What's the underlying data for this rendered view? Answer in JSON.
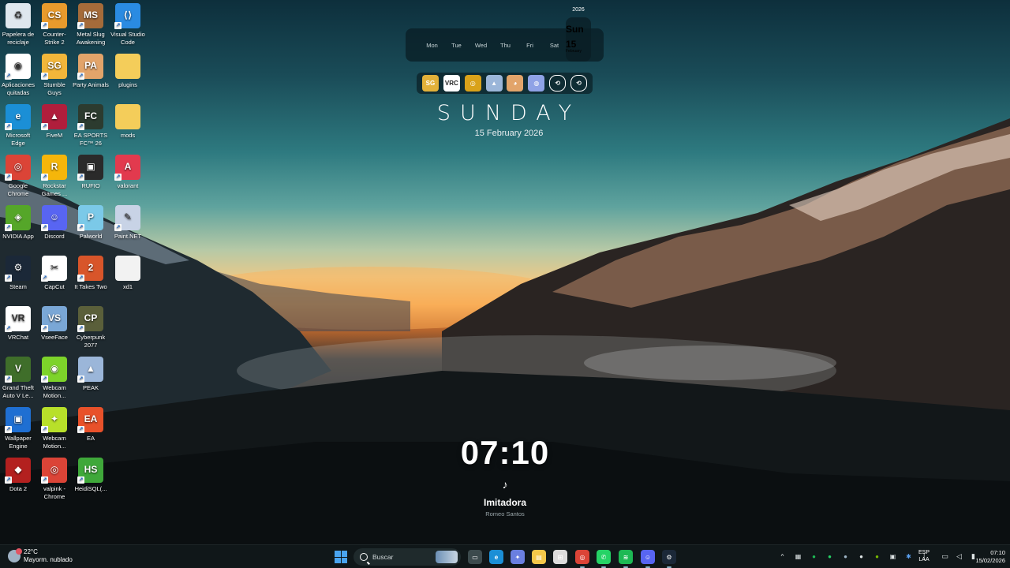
{
  "desktop": {
    "icons": [
      {
        "label": "Papelera de reciclaje",
        "icon": "recycle-bin-icon",
        "color": "#dfe7ee",
        "glyph": "♻"
      },
      {
        "label": "Counter-Strike 2",
        "icon": "counter-strike-icon",
        "color": "#e89a2c",
        "glyph": "CS"
      },
      {
        "label": "Metal Slug Awakening",
        "icon": "metal-slug-icon",
        "color": "#a56b3a",
        "glyph": "MS"
      },
      {
        "label": "Visual Studio Code",
        "icon": "vscode-icon",
        "color": "#2a8be2",
        "glyph": "⟨⟩"
      },
      {
        "label": "Aplicaciones quitadas",
        "icon": "removed-apps-icon",
        "color": "#ffffff",
        "glyph": "◉"
      },
      {
        "label": "Stumble Guys",
        "icon": "stumble-guys-icon",
        "color": "#f2b63a",
        "glyph": "SG"
      },
      {
        "label": "Party Animals",
        "icon": "party-animals-icon",
        "color": "#e2a46a",
        "glyph": "PA"
      },
      {
        "label": "plugins",
        "icon": "folder-icon",
        "color": "#f4cd5a",
        "glyph": ""
      },
      {
        "label": "Microsoft Edge",
        "icon": "edge-icon",
        "color": "#1b8fd6",
        "glyph": "e"
      },
      {
        "label": "FiveM",
        "icon": "fivem-icon",
        "color": "#b01e3c",
        "glyph": "▲"
      },
      {
        "label": "EA SPORTS FC™ 26",
        "icon": "ea-fc-icon",
        "color": "#2c3b2f",
        "glyph": "FC"
      },
      {
        "label": "mods",
        "icon": "folder-icon",
        "color": "#f4cd5a",
        "glyph": ""
      },
      {
        "label": "Google Chrome",
        "icon": "chrome-icon",
        "color": "#db4437",
        "glyph": "◎"
      },
      {
        "label": "Rockstar Games ...",
        "icon": "rockstar-icon",
        "color": "#f5b60a",
        "glyph": "R"
      },
      {
        "label": "RUFIO",
        "icon": "rufio-icon",
        "color": "#2a2a2a",
        "glyph": "▣"
      },
      {
        "label": "valorant",
        "icon": "valorant-icon",
        "color": "#e23a4e",
        "glyph": "A"
      },
      {
        "label": "NVIDIA App",
        "icon": "nvidia-icon",
        "color": "#55a629",
        "glyph": "◈"
      },
      {
        "label": "Discord",
        "icon": "discord-icon",
        "color": "#5865f2",
        "glyph": "☺"
      },
      {
        "label": "Palworld",
        "icon": "palworld-icon",
        "color": "#7bc9e8",
        "glyph": "P"
      },
      {
        "label": "Paint.NET",
        "icon": "paint-net-icon",
        "color": "#c8d3e6",
        "glyph": "✎"
      },
      {
        "label": "Steam",
        "icon": "steam-icon",
        "color": "#1b2838",
        "glyph": "⚙"
      },
      {
        "label": "CapCut",
        "icon": "capcut-icon",
        "color": "#ffffff",
        "glyph": "✂"
      },
      {
        "label": "It Takes Two",
        "icon": "it-takes-two-icon",
        "color": "#d8552a",
        "glyph": "2"
      },
      {
        "label": "xd1",
        "icon": "file-icon",
        "color": "#f2f2f2",
        "glyph": ""
      },
      {
        "label": "VRChat",
        "icon": "vrchat-icon",
        "color": "#ffffff",
        "glyph": "VR"
      },
      {
        "label": "VseeFace",
        "icon": "vseeface-icon",
        "color": "#7aa7d6",
        "glyph": "VS"
      },
      {
        "label": "Cyberpunk 2077",
        "icon": "cyberpunk-icon",
        "color": "#5a5f3a",
        "glyph": "CP"
      },
      {
        "label": "",
        "icon": "blank-icon",
        "color": "transparent",
        "glyph": ""
      },
      {
        "label": "Grand Theft Auto V Le...",
        "icon": "gta-icon",
        "color": "#3f6e2a",
        "glyph": "V"
      },
      {
        "label": "Webcam Motion...",
        "icon": "webcam-motion-icon",
        "color": "#7dd32a",
        "glyph": "◉"
      },
      {
        "label": "PEAK",
        "icon": "peak-icon",
        "color": "#9bb6d9",
        "glyph": "▲"
      },
      {
        "label": "",
        "icon": "blank-icon",
        "color": "transparent",
        "glyph": ""
      },
      {
        "label": "Wallpaper Engine",
        "icon": "wallpaper-engine-icon",
        "color": "#1f6fd2",
        "glyph": "▣"
      },
      {
        "label": "Webcam Motion...",
        "icon": "webcam-motion-icon",
        "color": "#b8e02a",
        "glyph": "✦"
      },
      {
        "label": "EA",
        "icon": "ea-icon",
        "color": "#e8512a",
        "glyph": "EA"
      },
      {
        "label": "",
        "icon": "blank-icon",
        "color": "transparent",
        "glyph": ""
      },
      {
        "label": "Dota 2",
        "icon": "dota2-icon",
        "color": "#b3201f",
        "glyph": "◆"
      },
      {
        "label": "valpink - Chrome",
        "icon": "chrome-icon",
        "color": "#db4437",
        "glyph": "◎"
      },
      {
        "label": "HeidiSQL(...",
        "icon": "heidisql-icon",
        "color": "#3fa83a",
        "glyph": "HS"
      }
    ]
  },
  "calendar": {
    "year": "2026",
    "days": [
      "Mon",
      "Tue",
      "Wed",
      "Thu",
      "Fri",
      "Sat"
    ],
    "today_name": "Sun",
    "today_number": "15",
    "today_month": "February"
  },
  "dock": {
    "items": [
      {
        "icon": "stumble-guys-icon",
        "color": "#e2b13a",
        "glyph": "SG"
      },
      {
        "icon": "vrchat-icon",
        "color": "#ffffff",
        "glyph": "VRC"
      },
      {
        "icon": "rufio-icon",
        "color": "#d9a21a",
        "glyph": "◎"
      },
      {
        "icon": "peak-icon",
        "color": "#9bb6d9",
        "glyph": "▲"
      },
      {
        "icon": "party-animals-icon",
        "color": "#e2a46a",
        "glyph": "◕"
      },
      {
        "icon": "globe-icon",
        "color": "#8fa2e6",
        "glyph": "◍"
      },
      {
        "icon": "link-icon",
        "color": "transparent",
        "glyph": "⟲"
      },
      {
        "icon": "link-icon",
        "color": "transparent",
        "glyph": "⟲"
      }
    ]
  },
  "date_widget": {
    "weekday": "SUNDAY",
    "full_date": "15 February 2026"
  },
  "clock": {
    "time": "07:10",
    "note_glyph": "♪",
    "song": "Imitadora",
    "artist": "Romeo Santos"
  },
  "taskbar": {
    "weather_temp": "22°C",
    "weather_desc": "Mayorm. nublado",
    "search_placeholder": "Buscar",
    "apps": [
      {
        "name": "task-view",
        "icon": "task-view-icon",
        "color": "#3c4a4d",
        "glyph": "▭"
      },
      {
        "name": "edge",
        "icon": "edge-icon",
        "color": "#1b8fd6",
        "glyph": "e"
      },
      {
        "name": "copilot",
        "icon": "copilot-icon",
        "color": "#6a7fe0",
        "glyph": "✦"
      },
      {
        "name": "explorer",
        "icon": "file-explorer-icon",
        "color": "#f4c84a",
        "glyph": "▤"
      },
      {
        "name": "store",
        "icon": "store-icon",
        "color": "#dcdcdc",
        "glyph": "⊞"
      },
      {
        "name": "chrome",
        "icon": "chrome-icon",
        "color": "#db4437",
        "glyph": "◎"
      },
      {
        "name": "whatsapp",
        "icon": "whatsapp-icon",
        "color": "#25d366",
        "glyph": "✆"
      },
      {
        "name": "spotify",
        "icon": "spotify-icon",
        "color": "#1db954",
        "glyph": "≋"
      },
      {
        "name": "discord",
        "icon": "discord-icon",
        "color": "#5865f2",
        "glyph": "☺"
      },
      {
        "name": "steam",
        "icon": "steam-icon",
        "color": "#1b2838",
        "glyph": "⚙"
      }
    ],
    "tray": [
      {
        "icon": "chevron-up-icon",
        "glyph": "^"
      },
      {
        "icon": "network-app-icon",
        "glyph": "▦"
      },
      {
        "icon": "spotify-tray-icon",
        "glyph": "●"
      },
      {
        "icon": "whatsapp-tray-icon",
        "glyph": "●"
      },
      {
        "icon": "steam-tray-icon",
        "glyph": "●"
      },
      {
        "icon": "discord-tray-icon",
        "glyph": "●"
      },
      {
        "icon": "nvidia-tray-icon",
        "glyph": "●"
      },
      {
        "icon": "usb-icon",
        "glyph": "▣"
      },
      {
        "icon": "bluetooth-icon",
        "glyph": "✱"
      },
      {
        "icon": "mic-icon",
        "glyph": "│"
      }
    ],
    "language_top": "ESP",
    "language_bottom": "LAA",
    "sys_icons": [
      {
        "icon": "display-icon",
        "glyph": "▭"
      },
      {
        "icon": "speaker-icon",
        "glyph": "◁"
      },
      {
        "icon": "battery-icon",
        "glyph": "▮"
      }
    ],
    "time": "07:10",
    "date": "15/02/2026"
  },
  "colors": {
    "start_blue": "#4aa4ef",
    "taskbar_bg": "#101719"
  }
}
